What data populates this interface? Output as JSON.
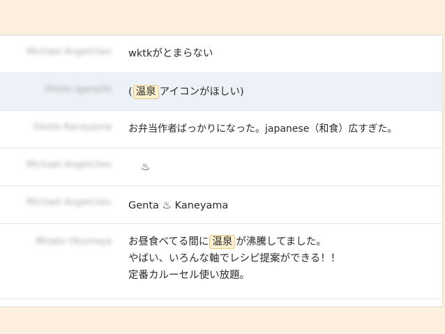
{
  "rows": [
    {
      "name": "Michael Angelchev",
      "message": "wktkがとまらない"
    },
    {
      "name": "Hiroto Igarashi",
      "open": "(",
      "tag": "温泉",
      "rest": "アイコンがほしい)"
    },
    {
      "name": "Genta Kaneyama",
      "message": "お弁当作者ばっかりになった。japanese（和食）広すぎた。"
    },
    {
      "name": "Michael Angelchev",
      "icon": "♨"
    },
    {
      "name": "Michael Angelchev",
      "before": "Genta",
      "icon": "♨",
      "after": "Kaneyama"
    },
    {
      "name": "Misato Okumaya",
      "line1_before": "お昼食べてる間に",
      "tag": "温泉",
      "line1_after": "が沸騰してました。",
      "line2": "やばい、いろんな軸でレシピ提案ができる！！",
      "line3": "定番カルーセル使い放題。"
    }
  ],
  "colors": {
    "background": "#fdf0de",
    "panel": "#ffffff",
    "highlight_row": "#edf2f8",
    "tag_bg": "#fdf1d2",
    "tag_border": "#e8c57c"
  }
}
